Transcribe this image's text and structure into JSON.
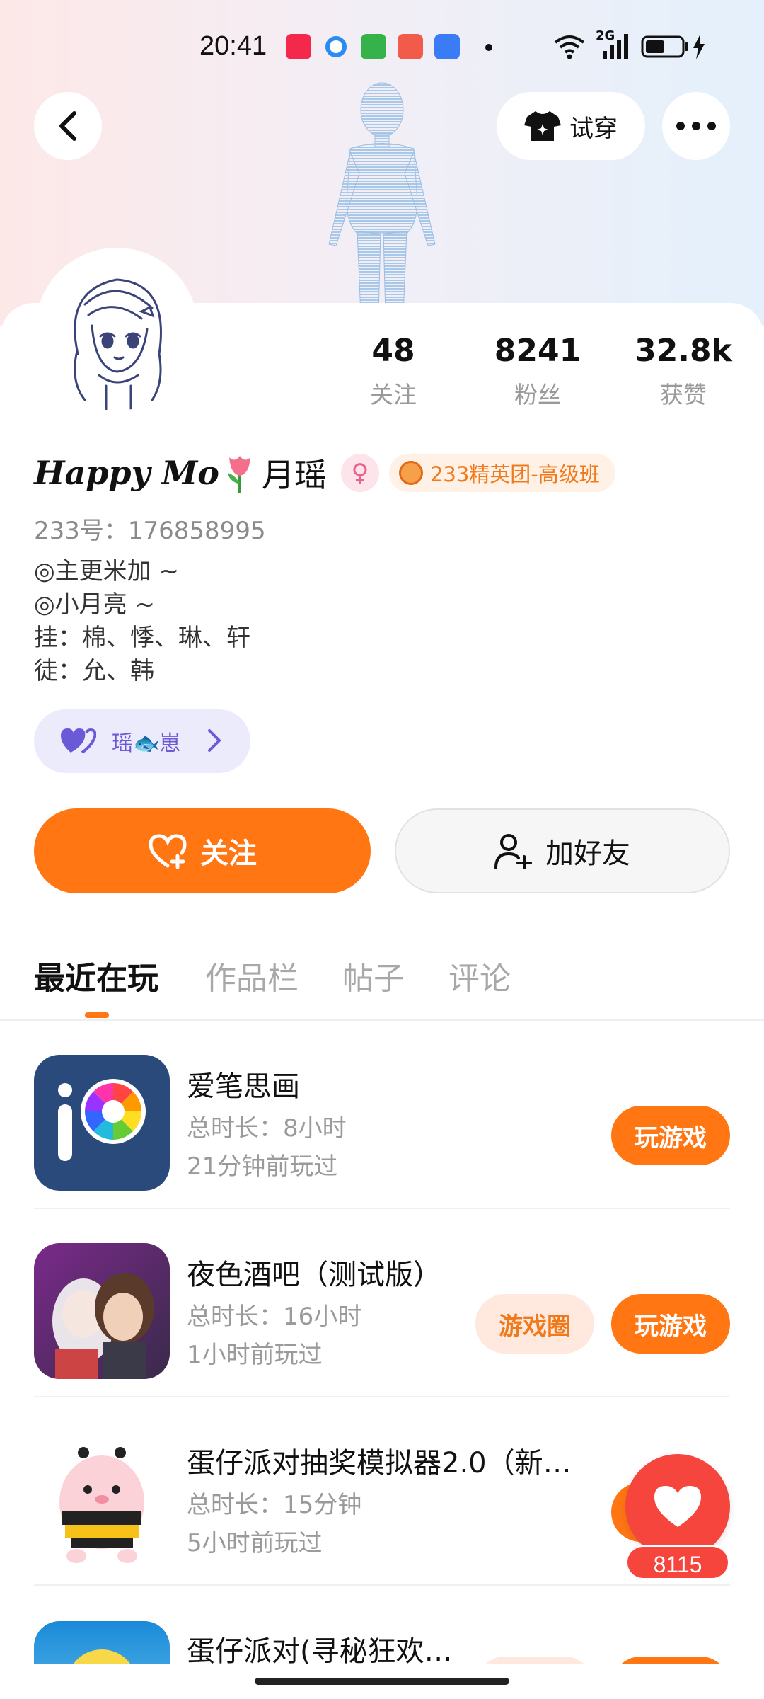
{
  "status_bar": {
    "time": "20:41",
    "network": "2G"
  },
  "header": {
    "try_on_label": "试穿"
  },
  "profile": {
    "stats": [
      {
        "value": "48",
        "label": "关注"
      },
      {
        "value": "8241",
        "label": "粉丝"
      },
      {
        "value": "32.8k",
        "label": "获赞"
      }
    ],
    "name_script": "Happy Mo",
    "name_cn": "月瑶",
    "gender_symbol": "♀",
    "badge": "233精英团-高级班",
    "uid": "233号：176858995",
    "bio": [
      "◎主更米加 ~",
      "◎小月亮 ~",
      "挂：棉、悸、琳、轩",
      "徒：允、韩"
    ],
    "fan_tag": "瑶🐟崽"
  },
  "actions": {
    "follow": "关注",
    "add_friend": "加好友"
  },
  "tabs": [
    {
      "label": "最近在玩",
      "active": true
    },
    {
      "label": "作品栏",
      "active": false
    },
    {
      "label": "帖子",
      "active": false
    },
    {
      "label": "评论",
      "active": false
    }
  ],
  "games": [
    {
      "title": "爱笔思画",
      "duration": "总时长：8小时",
      "last_played": "21分钟前玩过",
      "play_label": "玩游戏"
    },
    {
      "title": "夜色酒吧（测试版）",
      "duration": "总时长：16小时",
      "last_played": "1小时前玩过",
      "circle_label": "游戏圈",
      "play_label": "玩游戏"
    },
    {
      "title": "蛋仔派对抽奖模拟器2.0（新…",
      "duration": "总时长：15分钟",
      "last_played": "5小时前玩过"
    },
    {
      "title": "蛋仔派对(寻秘狂欢…"
    }
  ],
  "like_fab": {
    "count": "8115"
  },
  "colors": {
    "accent": "#ff7613",
    "like": "#f5453d",
    "fan_tag_text": "#6a5ad8"
  }
}
